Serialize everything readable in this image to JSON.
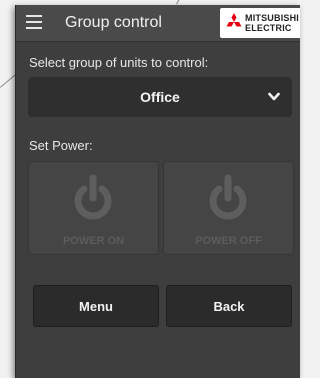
{
  "header": {
    "title": "Group control",
    "logo_line1": "MITSUBISHI",
    "logo_line2": "ELECTRIC"
  },
  "group_select": {
    "label": "Select group of units to control:",
    "selected": "Office"
  },
  "power": {
    "label": "Set Power:",
    "on_label": "POWER ON",
    "off_label": "POWER OFF"
  },
  "footer": {
    "menu_label": "Menu",
    "back_label": "Back"
  },
  "colors": {
    "background": "#3e3e3e",
    "logo_red": "#e60012"
  }
}
